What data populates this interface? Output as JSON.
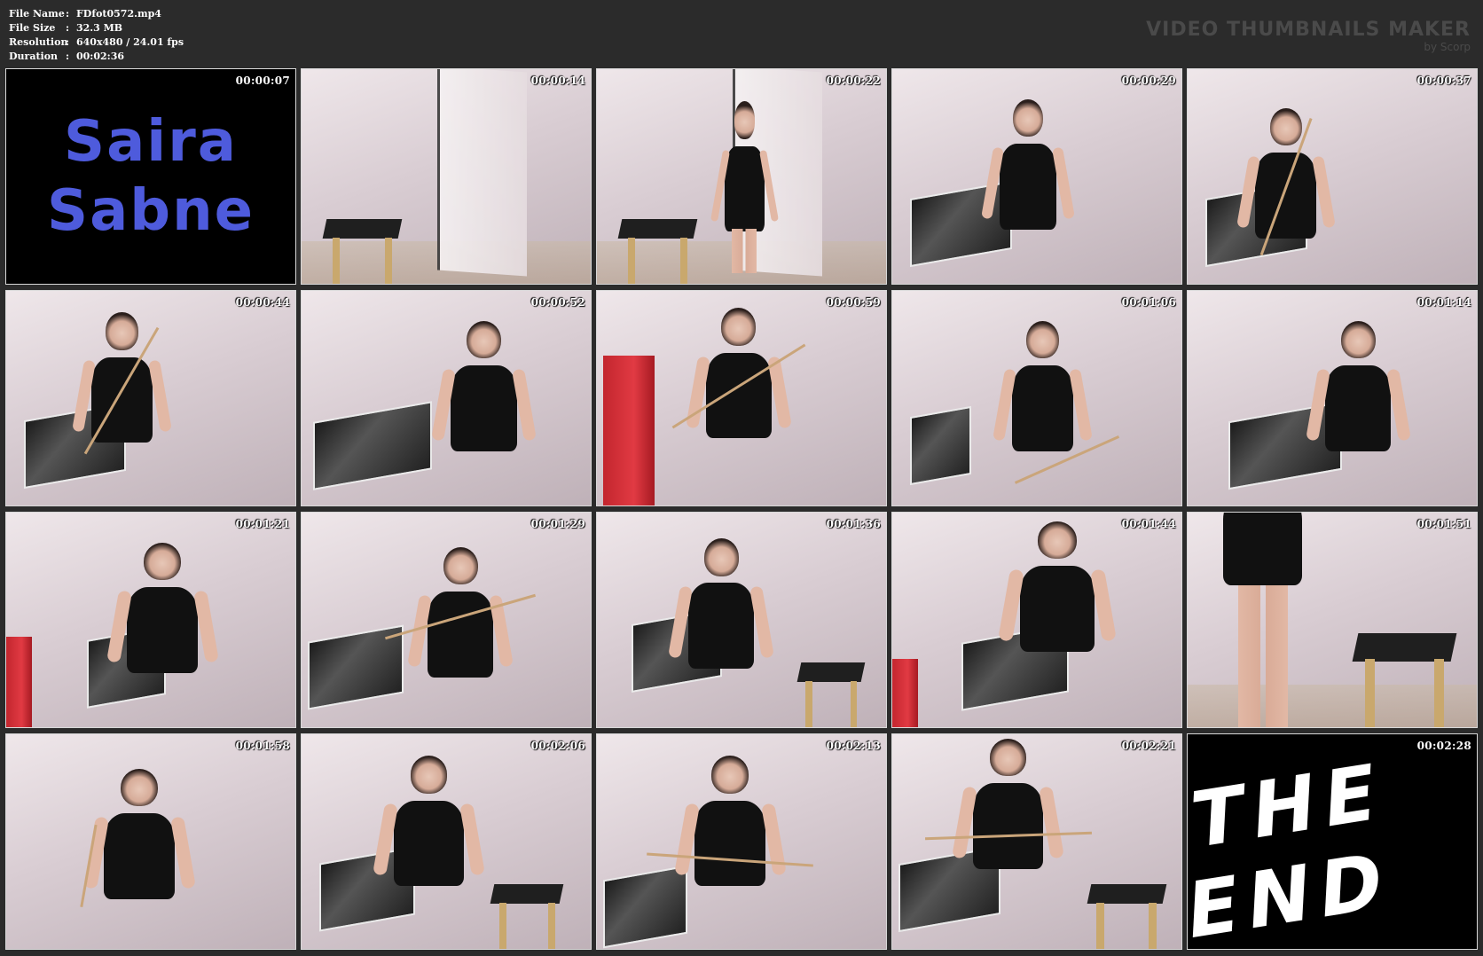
{
  "header": {
    "file_name_label": "File Name",
    "file_name": "FDfot0572.mp4",
    "file_size_label": "File Size",
    "file_size": "32.3 MB",
    "resolution_label": "Resolution",
    "resolution": "640x480 / 24.01 fps",
    "duration_label": "Duration",
    "duration": "00:02:36",
    "separator": ":"
  },
  "brand": {
    "title": "VIDEO THUMBNAILS MAKER",
    "subtitle": "by Scorp"
  },
  "title_card": {
    "line1": "Saira",
    "line2": "Sabne"
  },
  "end_card": {
    "text": "THE END"
  },
  "thumbnails": [
    {
      "time": "00:00:07"
    },
    {
      "time": "00:00:14"
    },
    {
      "time": "00:00:22"
    },
    {
      "time": "00:00:29"
    },
    {
      "time": "00:00:37"
    },
    {
      "time": "00:00:44"
    },
    {
      "time": "00:00:52"
    },
    {
      "time": "00:00:59"
    },
    {
      "time": "00:01:06"
    },
    {
      "time": "00:01:14"
    },
    {
      "time": "00:01:21"
    },
    {
      "time": "00:01:29"
    },
    {
      "time": "00:01:36"
    },
    {
      "time": "00:01:44"
    },
    {
      "time": "00:01:51"
    },
    {
      "time": "00:01:58"
    },
    {
      "time": "00:02:06"
    },
    {
      "time": "00:02:13"
    },
    {
      "time": "00:02:21"
    },
    {
      "time": "00:02:28"
    }
  ]
}
